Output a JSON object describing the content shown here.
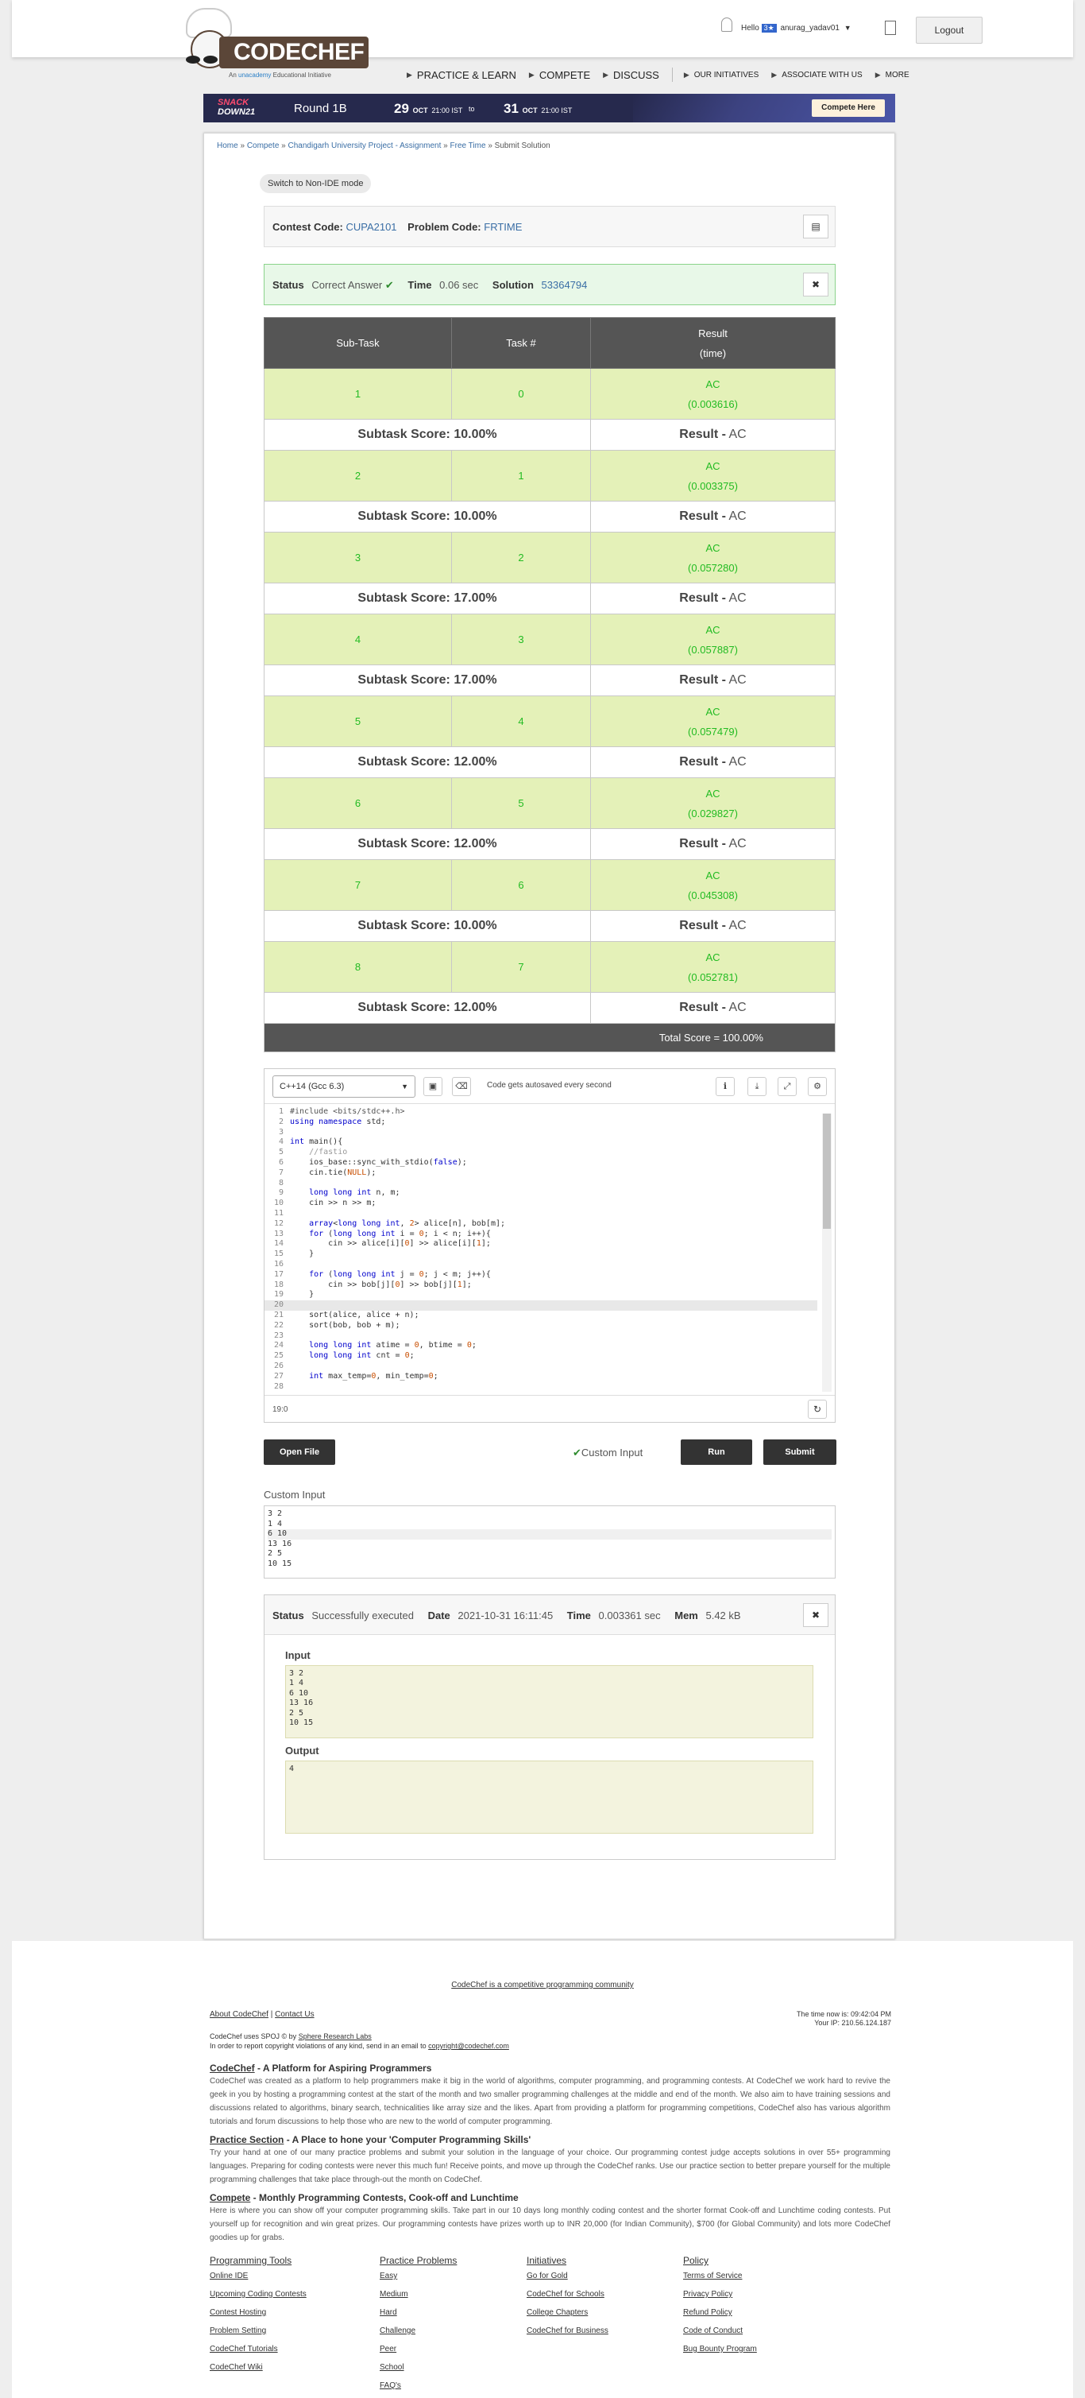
{
  "header": {
    "logo_text": "CODECHEF",
    "logo_sub_prefix": "An",
    "logo_sub_brand": "unacademy",
    "logo_sub_suffix": "Educational Initiative",
    "hello_prefix": "Hello",
    "user_star": "3★",
    "username": "anurag_yadav01",
    "logout_label": "Logout",
    "nav": [
      {
        "label": "PRACTICE & LEARN"
      },
      {
        "label": "COMPETE"
      },
      {
        "label": "DISCUSS"
      },
      {
        "label": "OUR INITIATIVES"
      },
      {
        "label": "ASSOCIATE WITH US"
      },
      {
        "label": "MORE"
      }
    ]
  },
  "banner": {
    "brand_line1": "SNACK",
    "brand_line2": "DOWN",
    "brand_year": "21",
    "round": "Round 1B",
    "start_day": "29",
    "start_month": "OCT",
    "start_time": "21:00 IST",
    "to": "to",
    "end_day": "31",
    "end_month": "OCT",
    "end_time": "21:00 IST",
    "cta": "Compete Here"
  },
  "breadcrumb": {
    "items": [
      "Home",
      "Compete",
      "Chandigarh University Project - Assignment",
      "Free Time",
      "Submit Solution"
    ],
    "sep": "»"
  },
  "switch_label": "Switch to Non-IDE mode",
  "contest": {
    "contest_code_label": "Contest Code:",
    "contest_code": "CUPA2101",
    "problem_code_label": "Problem Code:",
    "problem_code": "FRTIME"
  },
  "status": {
    "status_label": "Status",
    "status_value": "Correct Answer",
    "time_label": "Time",
    "time_value": "0.06 sec",
    "solution_label": "Solution",
    "solution_value": "53364794"
  },
  "results": {
    "headers": [
      "Sub-Task",
      "Task #",
      "Result"
    ],
    "result_sub": "(time)",
    "score_prefix": "Subtask Score:",
    "result_prefix": "Result -",
    "rows": [
      {
        "subtask": "1",
        "task": "0",
        "verdict": "AC",
        "time": "(0.003616)",
        "score": "10.00%",
        "result": "AC"
      },
      {
        "subtask": "2",
        "task": "1",
        "verdict": "AC",
        "time": "(0.003375)",
        "score": "10.00%",
        "result": "AC"
      },
      {
        "subtask": "3",
        "task": "2",
        "verdict": "AC",
        "time": "(0.057280)",
        "score": "17.00%",
        "result": "AC"
      },
      {
        "subtask": "4",
        "task": "3",
        "verdict": "AC",
        "time": "(0.057887)",
        "score": "17.00%",
        "result": "AC"
      },
      {
        "subtask": "5",
        "task": "4",
        "verdict": "AC",
        "time": "(0.057479)",
        "score": "12.00%",
        "result": "AC"
      },
      {
        "subtask": "6",
        "task": "5",
        "verdict": "AC",
        "time": "(0.029827)",
        "score": "12.00%",
        "result": "AC"
      },
      {
        "subtask": "7",
        "task": "6",
        "verdict": "AC",
        "time": "(0.045308)",
        "score": "10.00%",
        "result": "AC"
      },
      {
        "subtask": "8",
        "task": "7",
        "verdict": "AC",
        "time": "(0.052781)",
        "score": "12.00%",
        "result": "AC"
      }
    ],
    "total": "Total Score = 100.00%"
  },
  "editor": {
    "language": "C++14 (Gcc 6.3)",
    "autosave": "Code gets autosaved every second",
    "cursor_pos": "19:0",
    "lines": [
      {
        "n": "1",
        "t": "#include <bits/stdc++.h>"
      },
      {
        "n": "2",
        "t": "using namespace std;"
      },
      {
        "n": "3",
        "t": ""
      },
      {
        "n": "4",
        "t": "int main(){"
      },
      {
        "n": "5",
        "t": "    //fastio"
      },
      {
        "n": "6",
        "t": "    ios_base::sync_with_stdio(false);"
      },
      {
        "n": "7",
        "t": "    cin.tie(NULL);"
      },
      {
        "n": "8",
        "t": ""
      },
      {
        "n": "9",
        "t": "    long long int n, m;"
      },
      {
        "n": "10",
        "t": "    cin >> n >> m;"
      },
      {
        "n": "11",
        "t": ""
      },
      {
        "n": "12",
        "t": "    array<long long int, 2> alice[n], bob[m];"
      },
      {
        "n": "13",
        "t": "    for (long long int i = 0; i < n; i++){"
      },
      {
        "n": "14",
        "t": "        cin >> alice[i][0] >> alice[i][1];"
      },
      {
        "n": "15",
        "t": "    }"
      },
      {
        "n": "16",
        "t": ""
      },
      {
        "n": "17",
        "t": "    for (long long int j = 0; j < m; j++){"
      },
      {
        "n": "18",
        "t": "        cin >> bob[j][0] >> bob[j][1];"
      },
      {
        "n": "19",
        "t": "    }"
      },
      {
        "n": "20",
        "t": ""
      },
      {
        "n": "21",
        "t": "    sort(alice, alice + n);"
      },
      {
        "n": "22",
        "t": "    sort(bob, bob + m);"
      },
      {
        "n": "23",
        "t": ""
      },
      {
        "n": "24",
        "t": "    long long int atime = 0, btime = 0;"
      },
      {
        "n": "25",
        "t": "    long long int cnt = 0;"
      },
      {
        "n": "26",
        "t": ""
      },
      {
        "n": "27",
        "t": "    int max_temp=0, min_temp=0;"
      },
      {
        "n": "28",
        "t": ""
      }
    ]
  },
  "actions": {
    "open_file": "Open File",
    "custom_input": "Custom Input",
    "run": "Run",
    "submit": "Submit"
  },
  "custom_input": {
    "label": "Custom Input",
    "lines": [
      "3 2",
      "1 4",
      "6 10",
      "13 16",
      "2 5",
      "10 15"
    ]
  },
  "execution": {
    "status_label": "Status",
    "status_value": "Successfully executed",
    "date_label": "Date",
    "date_value": "2021-10-31 16:11:45",
    "time_label": "Time",
    "time_value": "0.003361 sec",
    "mem_label": "Mem",
    "mem_value": "5.42 kB",
    "input_label": "Input",
    "input_lines": [
      "3 2",
      "1 4",
      "6 10",
      "13 16",
      "2 5",
      "10 15"
    ],
    "output_label": "Output",
    "output_lines": [
      "4"
    ]
  },
  "footer": {
    "tagline": "CodeChef is a competitive programming community",
    "about": "About CodeChef",
    "contact": "Contact Us",
    "spoj_prefix": "CodeChef uses SPOJ © by",
    "spoj_link": "Sphere Research Labs",
    "copyright_line": "In order to report copyright violations of any kind, send in an email to",
    "copyright_email": "copyright@codechef.com",
    "time_now": "The time now is: 09:42:04 PM",
    "ip": "Your IP: 210.56.124.187",
    "sections": [
      {
        "link": "CodeChef",
        "title": " - A Platform for Aspiring Programmers",
        "text": "CodeChef was created as a platform to help programmers make it big in the world of algorithms, computer programming, and programming contests. At CodeChef we work hard to revive the geek in you by hosting a programming contest at the start of the month and two smaller programming challenges at the middle and end of the month. We also aim to have training sessions and discussions related to algorithms, binary search, technicalities like array size and the likes. Apart from providing a platform for programming competitions, CodeChef also has various algorithm tutorials and forum discussions to help those who are new to the world of computer programming."
      },
      {
        "link": "Practice Section",
        "title": " - A Place to hone your 'Computer Programming Skills'",
        "text": "Try your hand at one of our many practice problems and submit your solution in the language of your choice. Our programming contest judge accepts solutions in over 55+ programming languages. Preparing for coding contests were never this much fun! Receive points, and move up through the CodeChef ranks. Use our practice section to better prepare yourself for the multiple programming challenges that take place through-out the month on CodeChef."
      },
      {
        "link": "Compete",
        "title": " - Monthly Programming Contests, Cook-off and Lunchtime",
        "text": "Here is where you can show off your computer programming skills. Take part in our 10 days long monthly coding contest and the shorter format Cook-off and Lunchtime coding contests. Put yourself up for recognition and win great prizes. Our programming contests have prizes worth up to INR 20,000 (for Indian Community), $700 (for Global Community) and lots more CodeChef goodies up for grabs."
      }
    ],
    "columns": [
      {
        "title": "Programming Tools",
        "links": [
          "Online IDE",
          "Upcoming Coding Contests",
          "Contest Hosting",
          "Problem Setting",
          "CodeChef Tutorials",
          "CodeChef Wiki"
        ]
      },
      {
        "title": "Practice Problems",
        "links": [
          "Easy",
          "Medium",
          "Hard",
          "Challenge",
          "Peer",
          "School",
          "FAQ's"
        ]
      },
      {
        "title": "Initiatives",
        "links": [
          "Go for Gold",
          "CodeChef for Schools",
          "College Chapters",
          "CodeChef for Business"
        ]
      },
      {
        "title": "Policy",
        "links": [
          "Terms of Service",
          "Privacy Policy",
          "Refund Policy",
          "Code of Conduct",
          "Bug Bounty Program"
        ]
      }
    ]
  },
  "colors": {
    "brand_brown": "#5b4638",
    "ac_green": "#22bb22",
    "ac_row_bg": "#e4f1b8",
    "header_dark": "#555555",
    "banner_navy": "#26294d"
  }
}
